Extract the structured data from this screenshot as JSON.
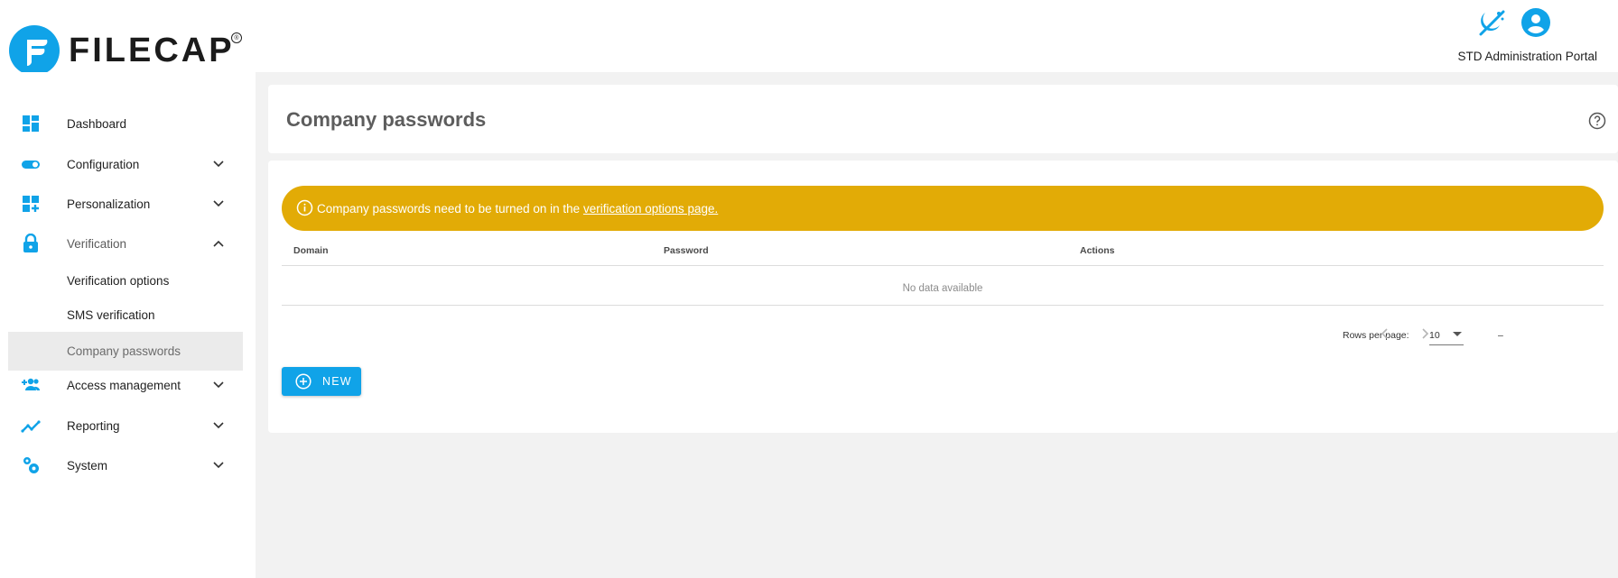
{
  "brand": {
    "name": "FILECAP",
    "registered_mark": "®",
    "accent": "#10a3e8"
  },
  "header": {
    "portal_label": "STD Administration Portal",
    "icons": [
      "theme-toggle-icon",
      "account-circle-icon"
    ]
  },
  "sidebar": {
    "items": [
      {
        "label": "Dashboard",
        "icon": "dashboard-icon",
        "expandable": false
      },
      {
        "label": "Configuration",
        "icon": "toggle-icon",
        "expandable": true,
        "expanded": false
      },
      {
        "label": "Personalization",
        "icon": "widgets-add-icon",
        "expandable": true,
        "expanded": false
      },
      {
        "label": "Verification",
        "icon": "lock-icon",
        "expandable": true,
        "expanded": true,
        "children": [
          {
            "label": "Verification options"
          },
          {
            "label": "SMS verification"
          },
          {
            "label": "Company passwords",
            "active": true
          }
        ]
      },
      {
        "label": "Access management",
        "icon": "group-add-icon",
        "expandable": true,
        "expanded": false
      },
      {
        "label": "Reporting",
        "icon": "trending-icon",
        "expandable": true,
        "expanded": false
      },
      {
        "label": "System",
        "icon": "settings-gears-icon",
        "expandable": true,
        "expanded": false
      }
    ]
  },
  "page": {
    "title": "Company passwords"
  },
  "alert": {
    "text": "Company passwords need to be turned on in the ",
    "link_text": "verification options page.",
    "color": "#e2ab06"
  },
  "table": {
    "columns": [
      "Domain",
      "Password",
      "Actions"
    ],
    "empty_text": "No data available"
  },
  "pagination": {
    "rows_per_page_label": "Rows per page:",
    "rows_per_page_value": "10",
    "range": "–"
  },
  "actions": {
    "new_label": "NEW"
  }
}
